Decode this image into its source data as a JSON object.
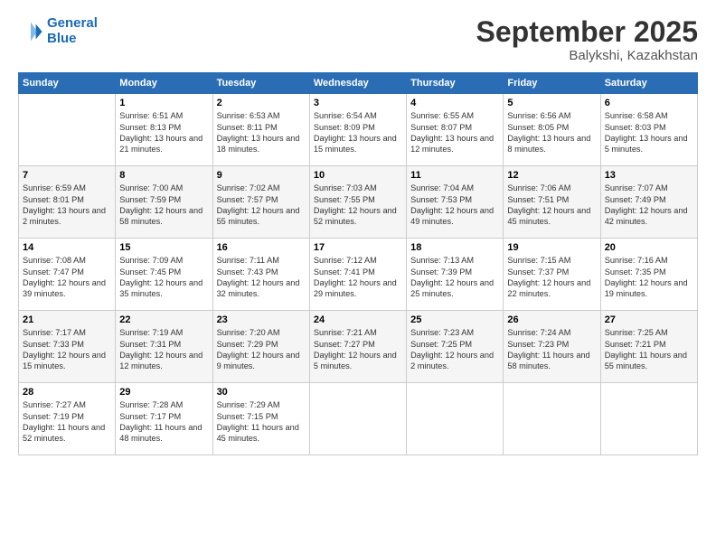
{
  "header": {
    "logo_line1": "General",
    "logo_line2": "Blue",
    "month": "September 2025",
    "location": "Balykshi, Kazakhstan"
  },
  "weekdays": [
    "Sunday",
    "Monday",
    "Tuesday",
    "Wednesday",
    "Thursday",
    "Friday",
    "Saturday"
  ],
  "weeks": [
    [
      {
        "day": "",
        "info": ""
      },
      {
        "day": "1",
        "info": "Sunrise: 6:51 AM\nSunset: 8:13 PM\nDaylight: 13 hours\nand 21 minutes."
      },
      {
        "day": "2",
        "info": "Sunrise: 6:53 AM\nSunset: 8:11 PM\nDaylight: 13 hours\nand 18 minutes."
      },
      {
        "day": "3",
        "info": "Sunrise: 6:54 AM\nSunset: 8:09 PM\nDaylight: 13 hours\nand 15 minutes."
      },
      {
        "day": "4",
        "info": "Sunrise: 6:55 AM\nSunset: 8:07 PM\nDaylight: 13 hours\nand 12 minutes."
      },
      {
        "day": "5",
        "info": "Sunrise: 6:56 AM\nSunset: 8:05 PM\nDaylight: 13 hours\nand 8 minutes."
      },
      {
        "day": "6",
        "info": "Sunrise: 6:58 AM\nSunset: 8:03 PM\nDaylight: 13 hours\nand 5 minutes."
      }
    ],
    [
      {
        "day": "7",
        "info": "Sunrise: 6:59 AM\nSunset: 8:01 PM\nDaylight: 13 hours\nand 2 minutes."
      },
      {
        "day": "8",
        "info": "Sunrise: 7:00 AM\nSunset: 7:59 PM\nDaylight: 12 hours\nand 58 minutes."
      },
      {
        "day": "9",
        "info": "Sunrise: 7:02 AM\nSunset: 7:57 PM\nDaylight: 12 hours\nand 55 minutes."
      },
      {
        "day": "10",
        "info": "Sunrise: 7:03 AM\nSunset: 7:55 PM\nDaylight: 12 hours\nand 52 minutes."
      },
      {
        "day": "11",
        "info": "Sunrise: 7:04 AM\nSunset: 7:53 PM\nDaylight: 12 hours\nand 49 minutes."
      },
      {
        "day": "12",
        "info": "Sunrise: 7:06 AM\nSunset: 7:51 PM\nDaylight: 12 hours\nand 45 minutes."
      },
      {
        "day": "13",
        "info": "Sunrise: 7:07 AM\nSunset: 7:49 PM\nDaylight: 12 hours\nand 42 minutes."
      }
    ],
    [
      {
        "day": "14",
        "info": "Sunrise: 7:08 AM\nSunset: 7:47 PM\nDaylight: 12 hours\nand 39 minutes."
      },
      {
        "day": "15",
        "info": "Sunrise: 7:09 AM\nSunset: 7:45 PM\nDaylight: 12 hours\nand 35 minutes."
      },
      {
        "day": "16",
        "info": "Sunrise: 7:11 AM\nSunset: 7:43 PM\nDaylight: 12 hours\nand 32 minutes."
      },
      {
        "day": "17",
        "info": "Sunrise: 7:12 AM\nSunset: 7:41 PM\nDaylight: 12 hours\nand 29 minutes."
      },
      {
        "day": "18",
        "info": "Sunrise: 7:13 AM\nSunset: 7:39 PM\nDaylight: 12 hours\nand 25 minutes."
      },
      {
        "day": "19",
        "info": "Sunrise: 7:15 AM\nSunset: 7:37 PM\nDaylight: 12 hours\nand 22 minutes."
      },
      {
        "day": "20",
        "info": "Sunrise: 7:16 AM\nSunset: 7:35 PM\nDaylight: 12 hours\nand 19 minutes."
      }
    ],
    [
      {
        "day": "21",
        "info": "Sunrise: 7:17 AM\nSunset: 7:33 PM\nDaylight: 12 hours\nand 15 minutes."
      },
      {
        "day": "22",
        "info": "Sunrise: 7:19 AM\nSunset: 7:31 PM\nDaylight: 12 hours\nand 12 minutes."
      },
      {
        "day": "23",
        "info": "Sunrise: 7:20 AM\nSunset: 7:29 PM\nDaylight: 12 hours\nand 9 minutes."
      },
      {
        "day": "24",
        "info": "Sunrise: 7:21 AM\nSunset: 7:27 PM\nDaylight: 12 hours\nand 5 minutes."
      },
      {
        "day": "25",
        "info": "Sunrise: 7:23 AM\nSunset: 7:25 PM\nDaylight: 12 hours\nand 2 minutes."
      },
      {
        "day": "26",
        "info": "Sunrise: 7:24 AM\nSunset: 7:23 PM\nDaylight: 11 hours\nand 58 minutes."
      },
      {
        "day": "27",
        "info": "Sunrise: 7:25 AM\nSunset: 7:21 PM\nDaylight: 11 hours\nand 55 minutes."
      }
    ],
    [
      {
        "day": "28",
        "info": "Sunrise: 7:27 AM\nSunset: 7:19 PM\nDaylight: 11 hours\nand 52 minutes."
      },
      {
        "day": "29",
        "info": "Sunrise: 7:28 AM\nSunset: 7:17 PM\nDaylight: 11 hours\nand 48 minutes."
      },
      {
        "day": "30",
        "info": "Sunrise: 7:29 AM\nSunset: 7:15 PM\nDaylight: 11 hours\nand 45 minutes."
      },
      {
        "day": "",
        "info": ""
      },
      {
        "day": "",
        "info": ""
      },
      {
        "day": "",
        "info": ""
      },
      {
        "day": "",
        "info": ""
      }
    ]
  ]
}
